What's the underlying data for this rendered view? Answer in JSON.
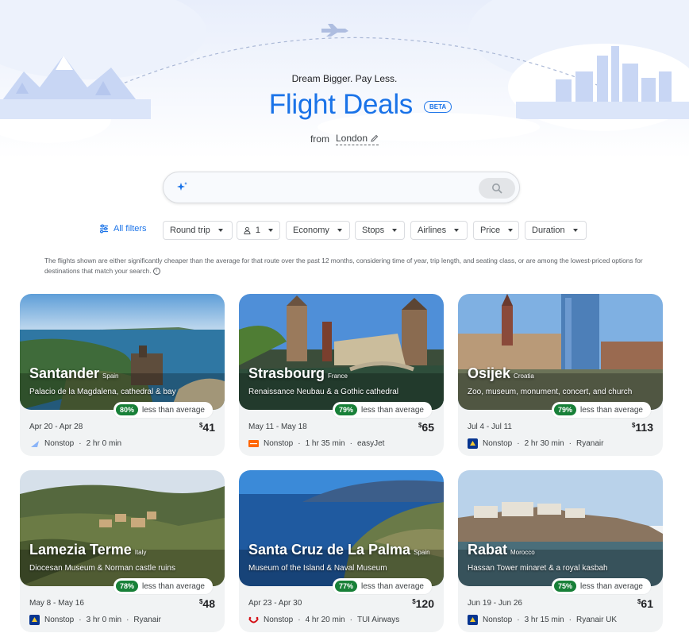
{
  "hero": {
    "tagline": "Dream Bigger. Pay Less.",
    "title": "Flight Deals",
    "beta": "BETA",
    "from_label": "from",
    "from_city": "London"
  },
  "search": {
    "placeholder": "",
    "value": ""
  },
  "filters": {
    "all_filters": "All filters",
    "trip_type": "Round trip",
    "passengers": "1",
    "class": "Economy",
    "stops": "Stops",
    "airlines": "Airlines",
    "price": "Price",
    "duration": "Duration"
  },
  "disclaimer": "The flights shown are either significantly cheaper than the average for that route over the past 12 months, considering time of year, trip length, and seating class, or are among the lowest-priced options for destinations that match your search.",
  "colors": {
    "accent": "#1a73e8",
    "deal_green": "#188038",
    "card_bg": "#f1f3f4"
  },
  "deals": [
    {
      "city": "Santander",
      "country": "Spain",
      "subtitle": "Palacio de la Magdalena, cathedral & bay",
      "pct": "80%",
      "pct_label": "less than average",
      "dates": "Apr 20 - Apr 28",
      "currency": "$",
      "price": "41",
      "stops": "Nonstop",
      "duration": "2 hr 0 min",
      "airline": "",
      "airline_icon": "generic-airline-icon"
    },
    {
      "city": "Strasbourg",
      "country": "France",
      "subtitle": "Renaissance Neubau & a Gothic cathedral",
      "pct": "79%",
      "pct_label": "less than average",
      "dates": "May 11 - May 18",
      "currency": "$",
      "price": "65",
      "stops": "Nonstop",
      "duration": "1 hr 35 min",
      "airline": "easyJet",
      "airline_icon": "easyjet-logo-icon"
    },
    {
      "city": "Osijek",
      "country": "Croatia",
      "subtitle": "Zoo, museum, monument, concert, and church",
      "pct": "79%",
      "pct_label": "less than average",
      "dates": "Jul 4 - Jul 11",
      "currency": "$",
      "price": "113",
      "stops": "Nonstop",
      "duration": "2 hr 30 min",
      "airline": "Ryanair",
      "airline_icon": "ryanair-logo-icon"
    },
    {
      "city": "Lamezia Terme",
      "country": "Italy",
      "subtitle": "Diocesan Museum & Norman castle ruins",
      "pct": "78%",
      "pct_label": "less than average",
      "dates": "May 8 - May 16",
      "currency": "$",
      "price": "48",
      "stops": "Nonstop",
      "duration": "3 hr 0 min",
      "airline": "Ryanair",
      "airline_icon": "ryanair-logo-icon"
    },
    {
      "city": "Santa Cruz de La Palma",
      "country": "Spain",
      "subtitle": "Museum of the Island & Naval Museum",
      "pct": "77%",
      "pct_label": "less than average",
      "dates": "Apr 23 - Apr 30",
      "currency": "$",
      "price": "120",
      "stops": "Nonstop",
      "duration": "4 hr 20 min",
      "airline": "TUI Airways",
      "airline_icon": "tui-logo-icon"
    },
    {
      "city": "Rabat",
      "country": "Morocco",
      "subtitle": "Hassan Tower minaret & a royal kasbah",
      "pct": "75%",
      "pct_label": "less than average",
      "dates": "Jun 19 - Jun 26",
      "currency": "$",
      "price": "61",
      "stops": "Nonstop",
      "duration": "3 hr 15 min",
      "airline": "Ryanair UK",
      "airline_icon": "ryanair-logo-icon"
    }
  ]
}
